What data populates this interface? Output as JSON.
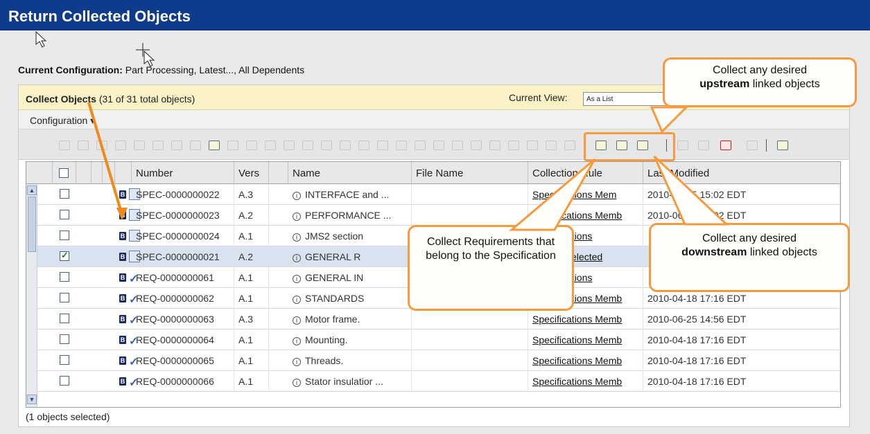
{
  "window": {
    "title": "Return Collected Objects"
  },
  "current_configuration": {
    "label": "Current Configuration:",
    "value": "Part Processing, Latest..., All Dependents"
  },
  "panel": {
    "title_bold": "Collect Objects",
    "title_count": "(31 of 31 total objects)",
    "current_view_label": "Current View:",
    "current_view_value": "As a List",
    "menu_configuration": "Configuration ▾"
  },
  "table": {
    "headers": [
      "Number",
      "Vers",
      "Name",
      "File Name",
      "Collection Rule",
      "Last Modified"
    ],
    "rows": [
      {
        "number": "SPEC-0000000022",
        "vers": "A.3",
        "name": "INTERFACE and ...",
        "file": "",
        "rule": "Specifications Mem",
        "modified": "2010-06-25 15:02 EDT",
        "checked": false,
        "selected": false,
        "kind": "spec"
      },
      {
        "number": "SPEC-0000000023",
        "vers": "A.2",
        "name": "PERFORMANCE ...",
        "file": "",
        "rule": "Specifications Memb",
        "modified": "2010-06-25 15:02 EDT",
        "checked": false,
        "selected": false,
        "kind": "spec"
      },
      {
        "number": "SPEC-0000000024",
        "vers": "A.1",
        "name": "JMS2 section",
        "file": "",
        "rule": "Specifications",
        "modified": "",
        "checked": false,
        "selected": false,
        "kind": "spec"
      },
      {
        "number": "SPEC-0000000021",
        "vers": "A.2",
        "name": "GENERAL R",
        "file": "",
        "rule": "Initially Selected",
        "modified": "",
        "checked": true,
        "selected": true,
        "kind": "spec"
      },
      {
        "number": "REQ-0000000061",
        "vers": "A.1",
        "name": "GENERAL IN",
        "file": "",
        "rule": "Specifications",
        "modified": "",
        "checked": false,
        "selected": false,
        "kind": "req"
      },
      {
        "number": "REQ-0000000062",
        "vers": "A.1",
        "name": "STANDARDS",
        "file": "",
        "rule": "Specifications Memb",
        "modified": "2010-04-18 17:16 EDT",
        "checked": false,
        "selected": false,
        "kind": "req"
      },
      {
        "number": "REQ-0000000063",
        "vers": "A.3",
        "name": "Motor frame.",
        "file": "",
        "rule": "Specifications Memb",
        "modified": "2010-06-25 14:56 EDT",
        "checked": false,
        "selected": false,
        "kind": "req"
      },
      {
        "number": "REQ-0000000064",
        "vers": "A.1",
        "name": "Mounting.",
        "file": "",
        "rule": "Specifications Memb",
        "modified": "2010-04-18 17:16 EDT",
        "checked": false,
        "selected": false,
        "kind": "req"
      },
      {
        "number": "REQ-0000000065",
        "vers": "A.1",
        "name": "Threads.",
        "file": "",
        "rule": "Specifications Memb",
        "modified": "2010-04-18 17:16 EDT",
        "checked": false,
        "selected": false,
        "kind": "req"
      },
      {
        "number": "REQ-0000000066",
        "vers": "A.1",
        "name": "Stator insulatior ...",
        "file": "",
        "rule": "Specifications Memb",
        "modified": "2010-04-18 17:16 EDT",
        "checked": false,
        "selected": false,
        "kind": "req"
      }
    ]
  },
  "status": "(1 objects selected)",
  "callouts": {
    "upstream_pre": "Collect any desired",
    "upstream_bold": "upstream",
    "upstream_post": "linked objects",
    "requirements": "Collect Requirements that belong to the Specification",
    "downstream_pre": "Collect any desired",
    "downstream_bold": "downstream",
    "downstream_post": "linked objects"
  },
  "colors": {
    "titlebar": "#0f3b8c",
    "callout_border": "#f59a3e",
    "panel_header": "#fbf3c7",
    "selected_row": "#d9e2ef"
  }
}
